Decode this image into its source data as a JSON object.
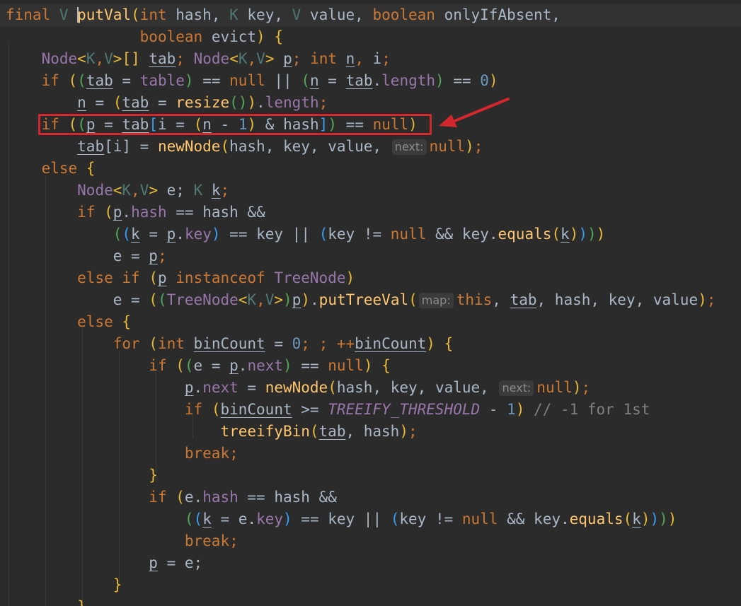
{
  "editor": {
    "colors": {
      "background": "#2b2b2b",
      "keyword": "#cc7832",
      "type": "#9876aa",
      "function": "#ffc66d",
      "number": "#6897bb",
      "comment": "#808080",
      "highlight_box": "#d4262d"
    },
    "annotation": {
      "box_line": 5,
      "arrow_icon": "red-arrow-icon"
    },
    "lines": [
      {
        "tokens": [
          {
            "t": "final ",
            "c": "kw"
          },
          {
            "t": "V ",
            "c": "tp"
          },
          {
            "caret": true
          },
          {
            "t": "putVal",
            "c": "fn"
          },
          {
            "t": "(",
            "c": "p1"
          },
          {
            "t": "int ",
            "c": "kw"
          },
          {
            "t": "hash, "
          },
          {
            "t": "K ",
            "c": "tp"
          },
          {
            "t": "key, "
          },
          {
            "t": "V ",
            "c": "tp"
          },
          {
            "t": "value, "
          },
          {
            "t": "boolean ",
            "c": "kw"
          },
          {
            "t": "onlyIfAbsent,"
          }
        ]
      },
      {
        "tokens": [
          {
            "t": "               "
          },
          {
            "t": "boolean ",
            "c": "kw"
          },
          {
            "t": "evict"
          },
          {
            "t": ")",
            "c": "p1"
          },
          {
            "t": " {",
            "c": "p1"
          }
        ]
      },
      {
        "tokens": [
          {
            "t": "    "
          },
          {
            "t": "Node",
            "c": "ty"
          },
          {
            "t": "<",
            "c": "p1"
          },
          {
            "t": "K",
            "c": "tp"
          },
          {
            "t": ",",
            "c": "kw"
          },
          {
            "t": "V",
            "c": "tp"
          },
          {
            "t": ">",
            "c": "p1"
          },
          {
            "t": "[] ",
            "c": "p1"
          },
          {
            "t": "tab",
            "c": "ul"
          },
          {
            "t": "; ",
            "c": "kw"
          },
          {
            "t": "Node",
            "c": "ty"
          },
          {
            "t": "<",
            "c": "p1"
          },
          {
            "t": "K",
            "c": "tp"
          },
          {
            "t": ",",
            "c": "kw"
          },
          {
            "t": "V",
            "c": "tp"
          },
          {
            "t": ">",
            "c": "p1"
          },
          {
            "t": " "
          },
          {
            "t": "p",
            "c": "ul"
          },
          {
            "t": "; ",
            "c": "kw"
          },
          {
            "t": "int ",
            "c": "kw"
          },
          {
            "t": "n",
            "c": "ul"
          },
          {
            "t": ", ",
            "c": "kw"
          },
          {
            "t": "i"
          },
          {
            "t": ";",
            "c": "kw"
          }
        ]
      },
      {
        "tokens": [
          {
            "t": "    "
          },
          {
            "t": "if ",
            "c": "kw"
          },
          {
            "t": "(",
            "c": "p1"
          },
          {
            "t": "(",
            "c": "p2"
          },
          {
            "t": "tab",
            "c": "ul"
          },
          {
            "t": " = "
          },
          {
            "t": "table",
            "c": "fd"
          },
          {
            "t": ")",
            "c": "p2"
          },
          {
            "t": " == "
          },
          {
            "t": "null ",
            "c": "kw"
          },
          {
            "t": "|| "
          },
          {
            "t": "(",
            "c": "p2"
          },
          {
            "t": "n",
            "c": "ul"
          },
          {
            "t": " = "
          },
          {
            "t": "tab",
            "c": "ul"
          },
          {
            "t": "."
          },
          {
            "t": "length",
            "c": "fd"
          },
          {
            "t": ")",
            "c": "p2"
          },
          {
            "t": " == "
          },
          {
            "t": "0",
            "c": "num"
          },
          {
            "t": ")",
            "c": "p1"
          }
        ]
      },
      {
        "tokens": [
          {
            "t": "        "
          },
          {
            "t": "n",
            "c": "ul"
          },
          {
            "t": " = "
          },
          {
            "t": "(",
            "c": "p1"
          },
          {
            "t": "tab",
            "c": "ul"
          },
          {
            "t": " = "
          },
          {
            "t": "resize",
            "c": "fn"
          },
          {
            "t": "()",
            "c": "p2"
          },
          {
            "t": ")",
            "c": "p1"
          },
          {
            "t": "."
          },
          {
            "t": "length",
            "c": "fd"
          },
          {
            "t": ";",
            "c": "kw"
          }
        ]
      },
      {
        "tokens": [
          {
            "t": "    "
          },
          {
            "t": "if ",
            "c": "kw"
          },
          {
            "t": "(",
            "c": "p1"
          },
          {
            "t": "(",
            "c": "p2"
          },
          {
            "t": "p",
            "c": "ul"
          },
          {
            "t": " = "
          },
          {
            "t": "tab",
            "c": "ul"
          },
          {
            "t": "[",
            "c": "p3"
          },
          {
            "t": "i = "
          },
          {
            "t": "(",
            "c": "p1"
          },
          {
            "t": "n",
            "c": "ul"
          },
          {
            "t": " - "
          },
          {
            "t": "1",
            "c": "num"
          },
          {
            "t": ")",
            "c": "p1"
          },
          {
            "t": " & hash"
          },
          {
            "t": "]",
            "c": "p3"
          },
          {
            "t": ")",
            "c": "p2"
          },
          {
            "t": " == "
          },
          {
            "t": "null",
            "c": "kw"
          },
          {
            "t": ")",
            "c": "p1"
          }
        ]
      },
      {
        "tokens": [
          {
            "t": "        "
          },
          {
            "t": "tab",
            "c": "ul"
          },
          {
            "t": "[i] = "
          },
          {
            "t": "newNode",
            "c": "fn"
          },
          {
            "t": "(",
            "c": "p1"
          },
          {
            "t": "hash, key, value, "
          },
          {
            "hint": "next:"
          },
          {
            "t": "null",
            "c": "kw"
          },
          {
            "t": ")",
            "c": "p1"
          },
          {
            "t": ";",
            "c": "kw"
          }
        ]
      },
      {
        "tokens": [
          {
            "t": "    "
          },
          {
            "t": "else ",
            "c": "kw"
          },
          {
            "t": "{",
            "c": "p1"
          }
        ]
      },
      {
        "tokens": [
          {
            "t": "        "
          },
          {
            "t": "Node",
            "c": "ty"
          },
          {
            "t": "<",
            "c": "p1"
          },
          {
            "t": "K",
            "c": "tp"
          },
          {
            "t": ",",
            "c": "kw"
          },
          {
            "t": "V",
            "c": "tp"
          },
          {
            "t": ">",
            "c": "p1"
          },
          {
            "t": " e; "
          },
          {
            "t": "K ",
            "c": "tp"
          },
          {
            "t": "k",
            "c": "ul"
          },
          {
            "t": ";",
            "c": "kw"
          }
        ]
      },
      {
        "tokens": [
          {
            "t": "        "
          },
          {
            "t": "if ",
            "c": "kw"
          },
          {
            "t": "(",
            "c": "p1"
          },
          {
            "t": "p",
            "c": "ul"
          },
          {
            "t": "."
          },
          {
            "t": "hash",
            "c": "fd"
          },
          {
            "t": " == hash &&"
          }
        ]
      },
      {
        "tokens": [
          {
            "t": "            "
          },
          {
            "t": "(",
            "c": "p2"
          },
          {
            "t": "(",
            "c": "p3"
          },
          {
            "t": "k",
            "c": "ul"
          },
          {
            "t": " = "
          },
          {
            "t": "p",
            "c": "ul"
          },
          {
            "t": "."
          },
          {
            "t": "key",
            "c": "fd"
          },
          {
            "t": ")",
            "c": "p3"
          },
          {
            "t": " == key || "
          },
          {
            "t": "(",
            "c": "p3"
          },
          {
            "t": "key != "
          },
          {
            "t": "null ",
            "c": "kw"
          },
          {
            "t": "&& key."
          },
          {
            "t": "equals",
            "c": "fn"
          },
          {
            "t": "(",
            "c": "p1"
          },
          {
            "t": "k",
            "c": "ul"
          },
          {
            "t": ")",
            "c": "p1"
          },
          {
            "t": ")",
            "c": "p3"
          },
          {
            "t": ")",
            "c": "p2"
          },
          {
            "t": ")",
            "c": "p1"
          }
        ]
      },
      {
        "tokens": [
          {
            "t": "            "
          },
          {
            "t": "e = "
          },
          {
            "t": "p",
            "c": "ul"
          },
          {
            "t": ";",
            "c": "kw"
          }
        ]
      },
      {
        "tokens": [
          {
            "t": "        "
          },
          {
            "t": "else if ",
            "c": "kw"
          },
          {
            "t": "(",
            "c": "p1"
          },
          {
            "t": "p",
            "c": "ul"
          },
          {
            "t": " instanceof ",
            "c": "kw"
          },
          {
            "t": "TreeNode",
            "c": "ty"
          },
          {
            "t": ")",
            "c": "p1"
          }
        ]
      },
      {
        "tokens": [
          {
            "t": "            "
          },
          {
            "t": "e = "
          },
          {
            "t": "(",
            "c": "p1"
          },
          {
            "t": "(",
            "c": "p2"
          },
          {
            "t": "TreeNode",
            "c": "ty"
          },
          {
            "t": "<",
            "c": "p1"
          },
          {
            "t": "K",
            "c": "tp"
          },
          {
            "t": ",",
            "c": "kw"
          },
          {
            "t": "V",
            "c": "tp"
          },
          {
            "t": ">",
            "c": "p1"
          },
          {
            "t": ")",
            "c": "p2"
          },
          {
            "t": "p",
            "c": "ul"
          },
          {
            "t": ")",
            "c": "p1"
          },
          {
            "t": "."
          },
          {
            "t": "putTreeVal",
            "c": "fn"
          },
          {
            "t": "(",
            "c": "p1"
          },
          {
            "hint": "map:"
          },
          {
            "t": "this",
            "c": "kw"
          },
          {
            "t": ", "
          },
          {
            "t": "tab",
            "c": "ul"
          },
          {
            "t": ", hash, key, value"
          },
          {
            "t": ")",
            "c": "p1"
          },
          {
            "t": ";",
            "c": "kw"
          }
        ]
      },
      {
        "tokens": [
          {
            "t": "        "
          },
          {
            "t": "else ",
            "c": "kw"
          },
          {
            "t": "{",
            "c": "p1"
          }
        ]
      },
      {
        "tokens": [
          {
            "t": "            "
          },
          {
            "t": "for ",
            "c": "kw"
          },
          {
            "t": "(",
            "c": "p1"
          },
          {
            "t": "int ",
            "c": "kw"
          },
          {
            "t": "binCount",
            "c": "ul"
          },
          {
            "t": " = "
          },
          {
            "t": "0",
            "c": "num"
          },
          {
            "t": "; ; ++",
            "c": "kw"
          },
          {
            "t": "binCount",
            "c": "ul"
          },
          {
            "t": ")",
            "c": "p1"
          },
          {
            "t": " {",
            "c": "p1"
          }
        ]
      },
      {
        "tokens": [
          {
            "t": "                "
          },
          {
            "t": "if ",
            "c": "kw"
          },
          {
            "t": "(",
            "c": "p1"
          },
          {
            "t": "(",
            "c": "p2"
          },
          {
            "t": "e = "
          },
          {
            "t": "p",
            "c": "ul"
          },
          {
            "t": "."
          },
          {
            "t": "next",
            "c": "fd"
          },
          {
            "t": ")",
            "c": "p2"
          },
          {
            "t": " == "
          },
          {
            "t": "null",
            "c": "kw"
          },
          {
            "t": ")",
            "c": "p1"
          },
          {
            "t": " {",
            "c": "p1"
          }
        ]
      },
      {
        "tokens": [
          {
            "t": "                    "
          },
          {
            "t": "p",
            "c": "ul"
          },
          {
            "t": "."
          },
          {
            "t": "next",
            "c": "fd"
          },
          {
            "t": " = "
          },
          {
            "t": "newNode",
            "c": "fn"
          },
          {
            "t": "(",
            "c": "p1"
          },
          {
            "t": "hash, key, value, "
          },
          {
            "hint": "next:"
          },
          {
            "t": "null",
            "c": "kw"
          },
          {
            "t": ")",
            "c": "p1"
          },
          {
            "t": ";",
            "c": "kw"
          }
        ]
      },
      {
        "tokens": [
          {
            "t": "                    "
          },
          {
            "t": "if ",
            "c": "kw"
          },
          {
            "t": "(",
            "c": "p1"
          },
          {
            "t": "binCount",
            "c": "ul"
          },
          {
            "t": " >= "
          },
          {
            "t": "TREEIFY_THRESHOLD",
            "c": "cst"
          },
          {
            "t": " - "
          },
          {
            "t": "1",
            "c": "num"
          },
          {
            "t": ")",
            "c": "p1"
          },
          {
            "t": " // -1 for 1st",
            "c": "cm"
          }
        ]
      },
      {
        "tokens": [
          {
            "t": "                        "
          },
          {
            "t": "treeifyBin",
            "c": "fn"
          },
          {
            "t": "(",
            "c": "p1"
          },
          {
            "t": "tab",
            "c": "ul"
          },
          {
            "t": ", hash"
          },
          {
            "t": ")",
            "c": "p1"
          },
          {
            "t": ";",
            "c": "kw"
          }
        ]
      },
      {
        "tokens": [
          {
            "t": "                    "
          },
          {
            "t": "break",
            "c": "kw"
          },
          {
            "t": ";",
            "c": "kw"
          }
        ]
      },
      {
        "tokens": [
          {
            "t": "                "
          },
          {
            "t": "}",
            "c": "p1"
          }
        ]
      },
      {
        "tokens": [
          {
            "t": "                "
          },
          {
            "t": "if ",
            "c": "kw"
          },
          {
            "t": "(",
            "c": "p1"
          },
          {
            "t": "e."
          },
          {
            "t": "hash",
            "c": "fd"
          },
          {
            "t": " == hash &&"
          }
        ]
      },
      {
        "tokens": [
          {
            "t": "                    "
          },
          {
            "t": "(",
            "c": "p2"
          },
          {
            "t": "(",
            "c": "p3"
          },
          {
            "t": "k",
            "c": "ul"
          },
          {
            "t": " = e."
          },
          {
            "t": "key",
            "c": "fd"
          },
          {
            "t": ")",
            "c": "p3"
          },
          {
            "t": " == key || "
          },
          {
            "t": "(",
            "c": "p3"
          },
          {
            "t": "key != "
          },
          {
            "t": "null ",
            "c": "kw"
          },
          {
            "t": "&& key."
          },
          {
            "t": "equals",
            "c": "fn"
          },
          {
            "t": "(",
            "c": "p1"
          },
          {
            "t": "k",
            "c": "ul"
          },
          {
            "t": ")",
            "c": "p1"
          },
          {
            "t": ")",
            "c": "p3"
          },
          {
            "t": ")",
            "c": "p2"
          },
          {
            "t": ")",
            "c": "p1"
          }
        ]
      },
      {
        "tokens": [
          {
            "t": "                    "
          },
          {
            "t": "break",
            "c": "kw"
          },
          {
            "t": ";",
            "c": "kw"
          }
        ]
      },
      {
        "tokens": [
          {
            "t": "                "
          },
          {
            "t": "p",
            "c": "ul"
          },
          {
            "t": " = e;"
          }
        ]
      },
      {
        "tokens": [
          {
            "t": "            "
          },
          {
            "t": "}",
            "c": "p1"
          }
        ]
      },
      {
        "tokens": [
          {
            "t": "        "
          },
          {
            "t": "}",
            "c": "p1"
          }
        ]
      }
    ]
  }
}
